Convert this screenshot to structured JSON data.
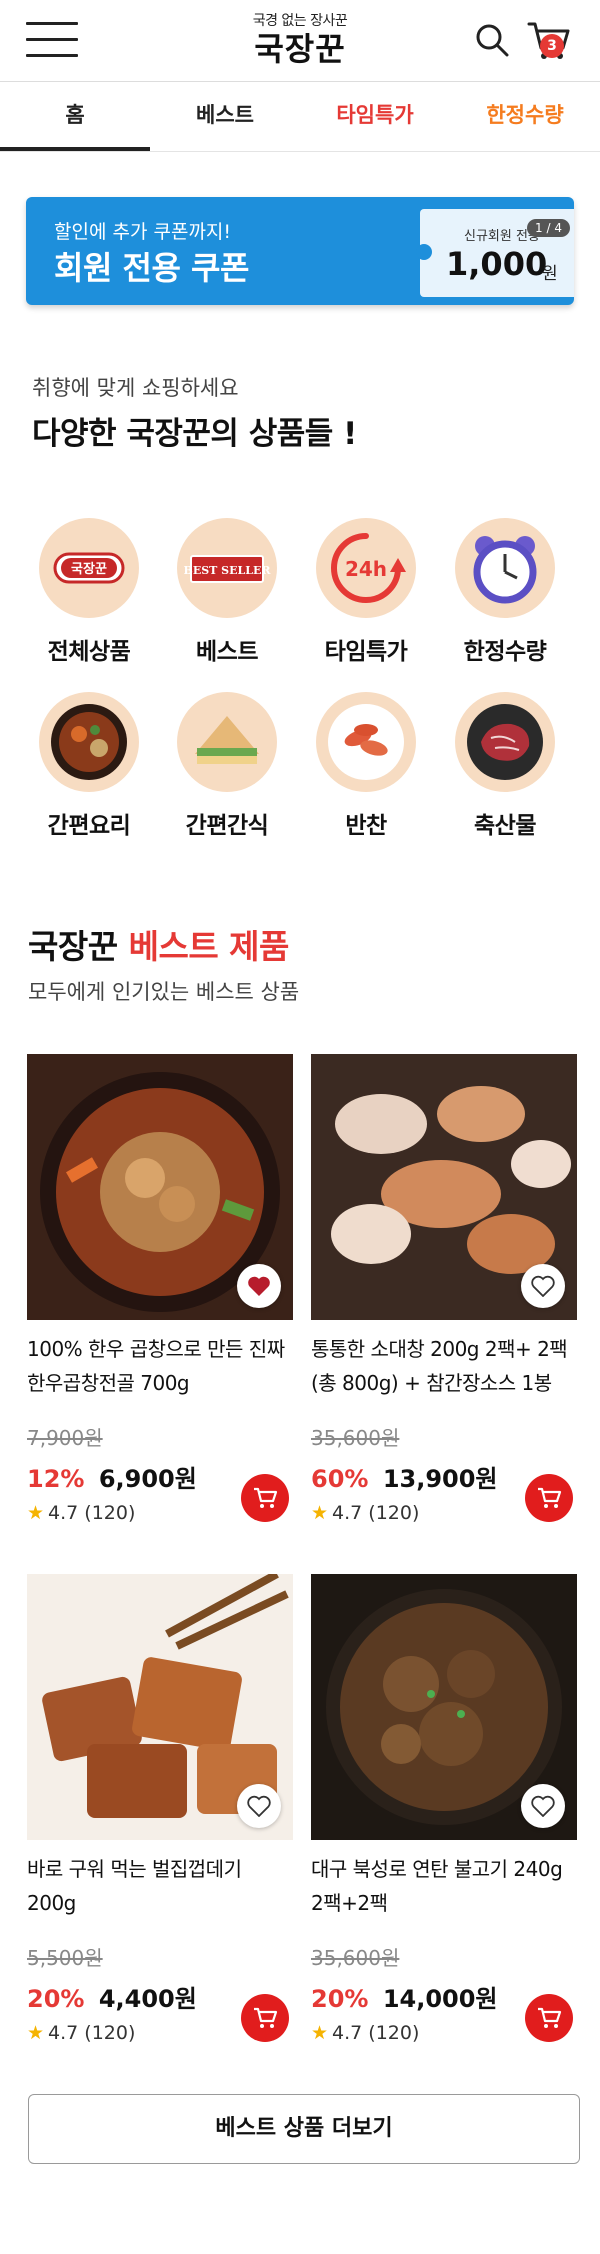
{
  "header": {
    "tagline": "국경 없는 장사꾼",
    "logo": "국장꾼",
    "cart_count": "3"
  },
  "tabs": [
    {
      "label": "홈"
    },
    {
      "label": "베스트"
    },
    {
      "label": "타임특가"
    },
    {
      "label": "한정수량"
    }
  ],
  "coupon": {
    "subtitle": "할인에 추가 쿠폰까지!",
    "title": "회원 전용 쿠폰",
    "ticket_label": "신규회원 전용",
    "amount": "1,000",
    "unit": "원",
    "page": "1 / 4"
  },
  "intro": {
    "subtitle": "취향에 맞게 쇼핑하세요",
    "title": "다양한 국장꾼의 상품들 !"
  },
  "categories": [
    {
      "label": "전체상품",
      "badge": "국장꾼"
    },
    {
      "label": "베스트",
      "badge": "BEST SELLER"
    },
    {
      "label": "타임특가",
      "badge": "24h"
    },
    {
      "label": "한정수량"
    },
    {
      "label": "간편요리"
    },
    {
      "label": "간편간식"
    },
    {
      "label": "반찬"
    },
    {
      "label": "축산물"
    }
  ],
  "best": {
    "title_prefix": "국장꾼",
    "title_highlight": "베스트 제품",
    "subtitle": "모두에게 인기있는 베스트 상품",
    "more_label": "베스트 상품 더보기"
  },
  "products": [
    {
      "name": "100% 한우 곱창으로 만든 진짜 한우곱창전골 700g",
      "original_price": "7,900원",
      "discount": "12%",
      "price": "6,900원",
      "rating": "4.7 (120)",
      "liked": true
    },
    {
      "name": "통통한 소대창 200g 2팩+ 2팩 (총 800g) + 참간장소스 1봉",
      "original_price": "35,600원",
      "discount": "60%",
      "price": "13,900원",
      "rating": "4.7 (120)",
      "liked": false
    },
    {
      "name": "바로 구워 먹는 벌집껍데기 200g",
      "original_price": "5,500원",
      "discount": "20%",
      "price": "4,400원",
      "rating": "4.7 (120)",
      "liked": false
    },
    {
      "name": "대구 북성로 연탄 불고기 240g 2팩+2팩",
      "original_price": "35,600원",
      "discount": "20%",
      "price": "14,000원",
      "rating": "4.7 (120)",
      "liked": false
    }
  ],
  "colors": {
    "accent_red": "#e53935",
    "accent_orange": "#f57c1f",
    "coupon_blue": "#1e8fdb"
  }
}
